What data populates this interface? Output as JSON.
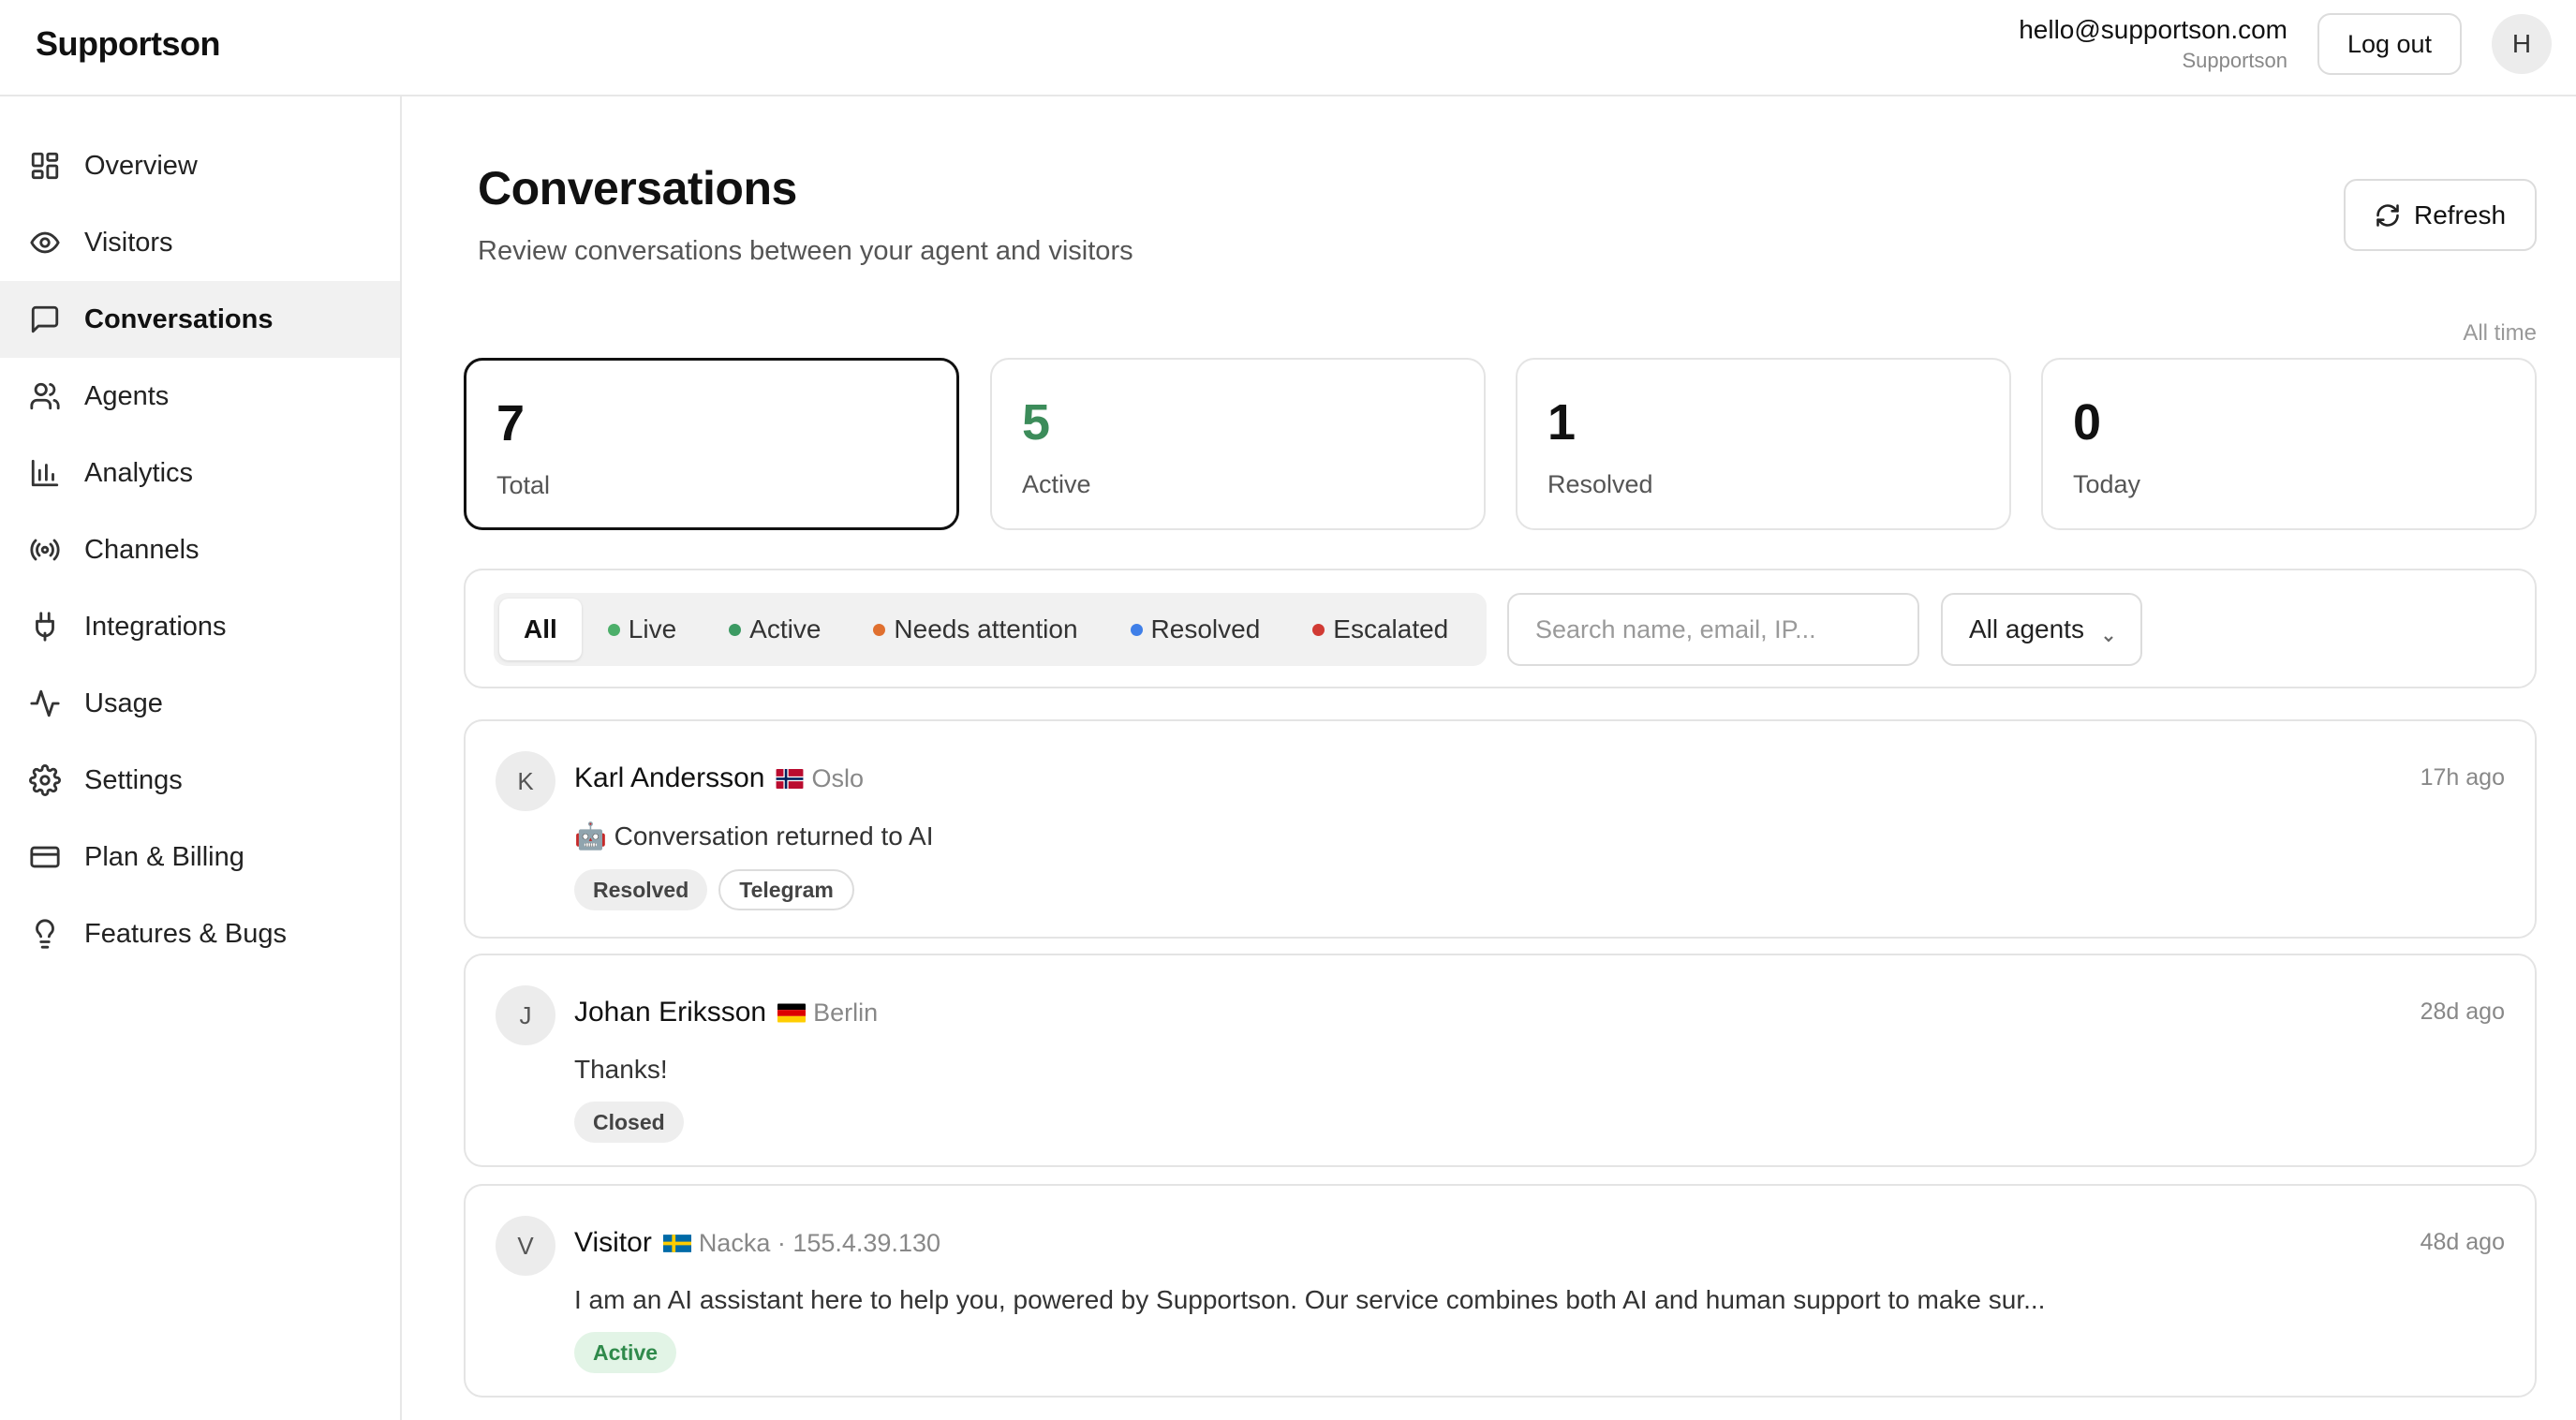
{
  "app": {
    "brand": "Supportson"
  },
  "header": {
    "email": "hello@supportson.com",
    "org": "Supportson",
    "logout_label": "Log out",
    "avatar_initial": "H"
  },
  "sidebar": {
    "items": [
      {
        "label": "Overview",
        "icon": "layout-grid-icon",
        "active": false
      },
      {
        "label": "Visitors",
        "icon": "eye-icon",
        "active": false
      },
      {
        "label": "Conversations",
        "icon": "message-square-icon",
        "active": true
      },
      {
        "label": "Agents",
        "icon": "users-icon",
        "active": false
      },
      {
        "label": "Analytics",
        "icon": "bar-chart-icon",
        "active": false
      },
      {
        "label": "Channels",
        "icon": "radio-icon",
        "active": false
      },
      {
        "label": "Integrations",
        "icon": "plug-icon",
        "active": false
      },
      {
        "label": "Usage",
        "icon": "activity-icon",
        "active": false
      },
      {
        "label": "Settings",
        "icon": "gear-icon",
        "active": false
      },
      {
        "label": "Plan & Billing",
        "icon": "credit-card-icon",
        "active": false
      },
      {
        "label": "Features & Bugs",
        "icon": "lightbulb-icon",
        "active": false
      }
    ]
  },
  "main": {
    "title": "Conversations",
    "subtitle": "Review conversations between your agent and visitors",
    "refresh_label": "Refresh",
    "range_label": "All time",
    "stats": [
      {
        "value": "7",
        "label": "Total"
      },
      {
        "value": "5",
        "label": "Active"
      },
      {
        "value": "1",
        "label": "Resolved"
      },
      {
        "value": "0",
        "label": "Today"
      }
    ],
    "filters": [
      {
        "label": "All",
        "dot_color": ""
      },
      {
        "label": "Live",
        "dot_color": "#4caf6a"
      },
      {
        "label": "Active",
        "dot_color": "#3c9a63"
      },
      {
        "label": "Needs attention",
        "dot_color": "#e0702f"
      },
      {
        "label": "Resolved",
        "dot_color": "#3f7fe8"
      },
      {
        "label": "Escalated",
        "dot_color": "#d13b34"
      }
    ],
    "search": {
      "placeholder": "Search name, email, IP...",
      "value": ""
    },
    "agent_filter": {
      "value": "All agents"
    },
    "conversations": [
      {
        "initial": "K",
        "name": "Karl Andersson",
        "flag": "norway-flag-icon",
        "location": "Oslo",
        "time": "17h ago",
        "message": "🤖 Conversation returned to AI",
        "badges": [
          "Resolved",
          "Telegram"
        ]
      },
      {
        "initial": "J",
        "name": "Johan Eriksson",
        "flag": "germany-flag-icon",
        "location": "Berlin",
        "time": "28d ago",
        "message": "Thanks!",
        "badges": [
          "Closed"
        ]
      },
      {
        "initial": "V",
        "name": "Visitor",
        "flag": "sweden-flag-icon",
        "location": "Nacka · 155.4.39.130",
        "time": "48d ago",
        "message": "I am an AI assistant here to help you, powered by Supportson. Our service combines both AI and human support to make sur...",
        "badges": [
          "Active"
        ]
      }
    ]
  }
}
